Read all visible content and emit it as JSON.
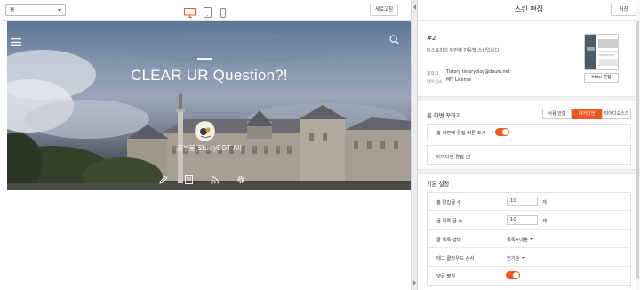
{
  "colors": {
    "accent": "#f0561f",
    "hero_sky": "#6f85a3",
    "text": "#333333"
  },
  "editor": {
    "page_select": {
      "value": "홈"
    },
    "device_icons": [
      "desktop-icon",
      "tablet-icon",
      "mobile-icon"
    ],
    "refresh_label": "새로고침"
  },
  "preview": {
    "title": "CLEAR UR Question?!",
    "author": "공부봇(StudyBOT AI)",
    "icons": [
      "menu-icon",
      "search-icon",
      "pencil-icon",
      "document-icon",
      "rss-icon",
      "gear-icon"
    ]
  },
  "panel": {
    "title": "스킨 편집",
    "save_label": "저장",
    "skin": {
      "name": "#2",
      "description": "티스토리의 두번째 반응형 스킨입니다.",
      "maker_label": "제작자",
      "maker_value": "Tistory tistoryblog@daum.net",
      "license_label": "라이선스",
      "license_value": "MIT License",
      "html_edit_label": "html 편집"
    },
    "home_section": {
      "title": "홈 화면 꾸미기",
      "tabs": [
        {
          "label": "사용 안함",
          "active": false
        },
        {
          "label": "티어디언",
          "active": true
        },
        {
          "label": "티어디오스크",
          "active": false
        }
      ],
      "show_edit_button_label": "홈 화면에 편집 버튼 표시",
      "show_edit_button_on": true,
      "editor_link_label": "티어디언 편집"
    },
    "basic_section": {
      "title": "기본 설정",
      "home_post_count_label": "홈 편집글 수",
      "home_post_count_value": "10",
      "home_post_count_unit": "개",
      "list_post_count_label": "글 목록 글 수",
      "list_post_count_value": "10",
      "list_post_count_unit": "개",
      "list_type_label": "글 목록 형태",
      "list_type_value": "목록+내용",
      "tag_cloud_label": "태그 클라우드 순서",
      "tag_cloud_value": "인기순",
      "comment_label": "댓글 펼침",
      "comment_on": true
    }
  }
}
